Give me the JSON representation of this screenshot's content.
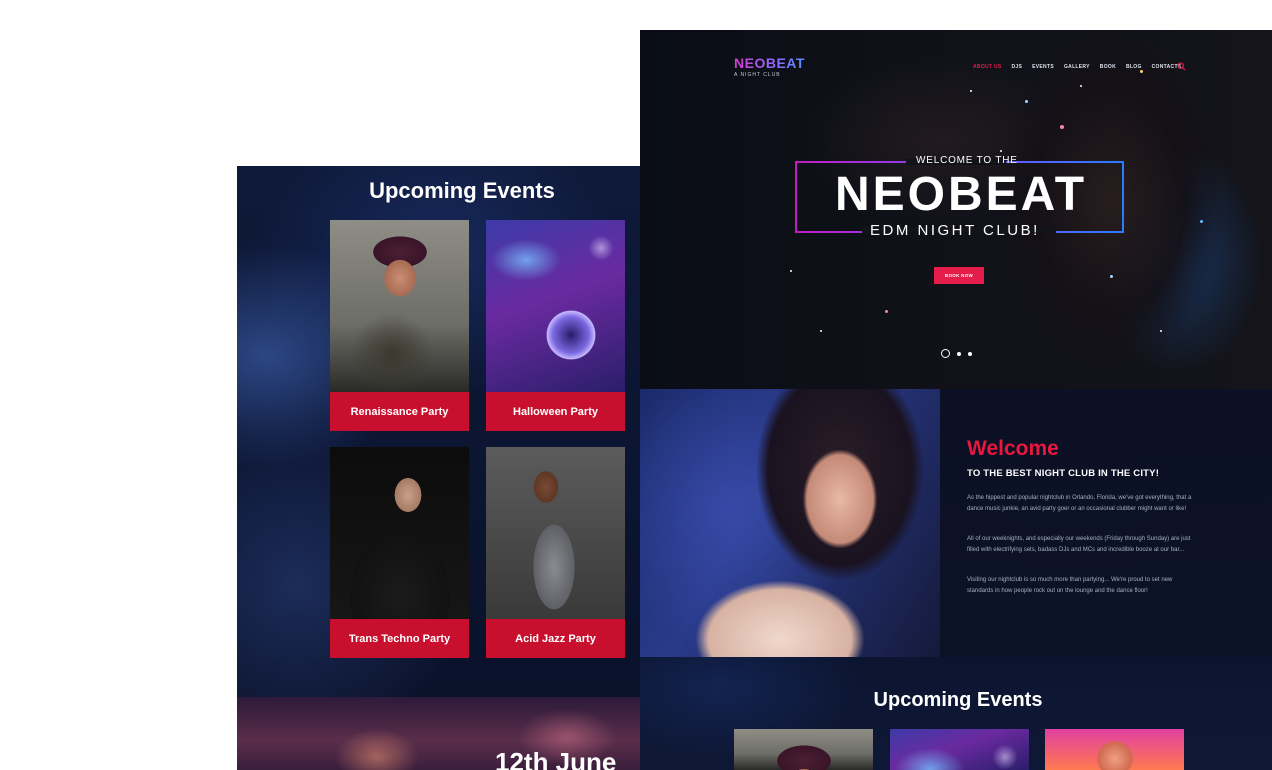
{
  "back_page": {
    "section_title": "Upcoming Events",
    "events": [
      {
        "label": "Renaissance Party",
        "image": "dj-woman-cap-photo"
      },
      {
        "label": "Halloween Party",
        "image": "headphones-dj-deck-photo"
      },
      {
        "label": "Trans Techno Party",
        "image": "dj-man-suit-photo"
      },
      {
        "label": "Acid Jazz Party",
        "image": "woman-headphones-photo"
      }
    ],
    "date_banner": "12th June"
  },
  "front_page": {
    "logo": {
      "title": "NEOBEAT",
      "subtitle": "A NIGHT CLUB"
    },
    "nav": {
      "items": [
        "ABOUT US",
        "DJS",
        "EVENTS",
        "GALLERY",
        "BOOK",
        "BLOG",
        "CONTACTS"
      ],
      "active_index": 0,
      "search_icon": "search-icon"
    },
    "hero": {
      "welcome": "WELCOME TO THE",
      "title": "NEOBEAT",
      "subtitle": "EDM NIGHT CLUB!",
      "button": "BOOK NOW",
      "slides": 3,
      "current_slide": 1
    },
    "welcome": {
      "heading": "Welcome",
      "subheading": "TO THE BEST NIGHT CLUB IN THE CITY!",
      "paragraphs": [
        "As the hippest and popular nightclub in Orlando, Florida, we've got everything, that a dance music junkie, an avid party goer or an occasional clubber might want or like!",
        "All of our weeknights, and especially our weekends (Friday through Sunday) are just filled with electrifying sets, badass DJs and MCs and incredible booze at our bar...",
        "Visiting our nightclub is so much more than partying... We're proud to set new standards in how people rock out on the lounge and the dance floor!"
      ]
    },
    "events": {
      "title": "Upcoming Events"
    }
  },
  "colors": {
    "accent": "#e51d4a",
    "card_label_bg": "#c8102e",
    "logo_gradient": [
      "#d43cd0",
      "#5a8dff"
    ],
    "frame_gradient": [
      "#c21cc0",
      "#2b7bff"
    ]
  }
}
